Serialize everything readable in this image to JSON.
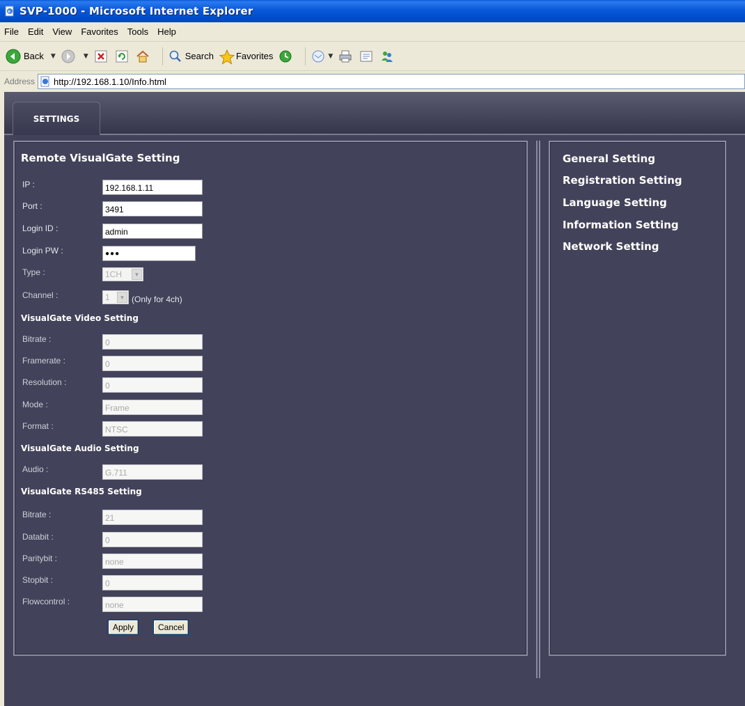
{
  "window": {
    "title": "SVP-1000 - Microsoft Internet Explorer"
  },
  "menu": [
    "File",
    "Edit",
    "View",
    "Favorites",
    "Tools",
    "Help"
  ],
  "toolbar": {
    "back_label": "Back",
    "search_label": "Search",
    "favorites_label": "Favorites"
  },
  "address": {
    "label": "Address",
    "url": "http://192.168.1.10/Info.html"
  },
  "tab": {
    "label": "SETTINGS"
  },
  "form": {
    "title": "Remote VisualGate Setting",
    "ip_label": "IP :",
    "ip_value": "192.168.1.11",
    "port_label": "Port :",
    "port_value": "3491",
    "login_id_label": "Login ID :",
    "login_id_value": "admin",
    "login_pw_label": "Login PW :",
    "login_pw_value": "●●●",
    "type_label": "Type :",
    "type_value": "1CH",
    "channel_label": "Channel :",
    "channel_value": "1",
    "channel_note": "(Only for 4ch)",
    "video_title": "VisualGate Video Setting",
    "bitrate_label": "Bitrate :",
    "bitrate_value": "0",
    "framerate_label": "Framerate :",
    "framerate_value": "0",
    "resolution_label": "Resolution :",
    "resolution_value": "0",
    "mode_label": "Mode :",
    "mode_value": "Frame",
    "format_label": "Format :",
    "format_value": "NTSC",
    "audio_title": "VisualGate Audio Setting",
    "audio_label": "Audio :",
    "audio_value": "G.711",
    "rs485_title": "VisualGate RS485 Setting",
    "rs_bitrate_label": "Bitrate :",
    "rs_bitrate_value": "21",
    "databit_label": "Databit :",
    "databit_value": "0",
    "paritybit_label": "Paritybit :",
    "paritybit_value": "none",
    "stopbit_label": "Stopbit :",
    "stopbit_value": "0",
    "flowcontrol_label": "Flowcontrol :",
    "flowcontrol_value": "none",
    "apply_label": "Apply",
    "cancel_label": "Cancel"
  },
  "nav": {
    "items": [
      "General Setting",
      "Registration Setting",
      "Language Setting",
      "Information Setting",
      "Network Setting"
    ]
  },
  "icons": {
    "app": "ie-page-icon",
    "back": "back-arrow-icon",
    "forward": "forward-arrow-icon",
    "stop": "stop-icon",
    "refresh": "refresh-icon",
    "home": "home-icon",
    "search": "search-icon",
    "favorites": "favorites-star-icon",
    "history": "history-icon",
    "mail": "mail-icon",
    "print": "print-icon",
    "edit": "edit-icon",
    "messenger": "messenger-icon"
  },
  "colors": {
    "page_bg": "#42425a",
    "panel_border": "#8a8aa0",
    "titlebar": "#0058d8"
  }
}
